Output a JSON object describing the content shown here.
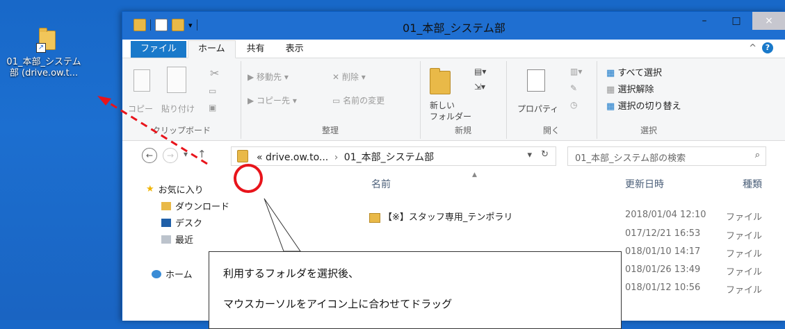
{
  "desktop": {
    "icon_label": "01_本部_システム部 (drive.ow.t..."
  },
  "window": {
    "title": "01_本部_システム部",
    "controls": {
      "minimize": "–",
      "maximize": "□",
      "close": "×"
    }
  },
  "ribbon_tabs": {
    "file": "ファイル",
    "home": "ホーム",
    "share": "共有",
    "view": "表示"
  },
  "ribbon": {
    "clipboard": {
      "copy": "コピー",
      "paste": "貼り付け",
      "caption": "クリップボード"
    },
    "organize": {
      "move_to": "移動先",
      "copy_to": "コピー先",
      "delete": "削除",
      "rename": "名前の変更",
      "caption": "整理"
    },
    "new": {
      "new_folder_line1": "新しい",
      "new_folder_line2": "フォルダー",
      "caption": "新規"
    },
    "open": {
      "properties": "プロパティ",
      "caption": "開く"
    },
    "select": {
      "select_all": "すべて選択",
      "select_none": "選択解除",
      "invert": "選択の切り替え",
      "caption": "選択"
    }
  },
  "address": {
    "crumb_prefix": "«",
    "crumb1": "drive.ow.to...",
    "separator": "›",
    "crumb2": "01_本部_システム部",
    "search_placeholder": "01_本部_システム部の検索"
  },
  "nav_pane": {
    "favorites": "お気に入り",
    "downloads": "ダウンロード",
    "desktop": "デスク",
    "recent": "最近",
    "homegroup": "ホーム"
  },
  "columns": {
    "name": "名前",
    "modified": "更新日時",
    "type": "種類"
  },
  "rows": [
    {
      "name": "【※】スタッフ専用_テンポラリ",
      "date": "2018/01/04 12:10",
      "type": "ファイル"
    },
    {
      "name": "",
      "date": "017/12/21 16:53",
      "type": "ファイル"
    },
    {
      "name": "",
      "date": "018/01/10 14:17",
      "type": "ファイル"
    },
    {
      "name": "",
      "date": "018/01/26 13:49",
      "type": "ファイル"
    },
    {
      "name": "",
      "date": "018/01/12 10:56",
      "type": "ファイル"
    }
  ],
  "callout": {
    "line1": "利用するフォルダを選択後、",
    "line2": "マウスカーソルをアイコン上に合わせてドラッグ"
  },
  "colors": {
    "desktop_bg": "#1a6ccc",
    "file_tab": "#1979ca",
    "highlight_circle": "#e8141b",
    "folder": "#e9b948"
  }
}
